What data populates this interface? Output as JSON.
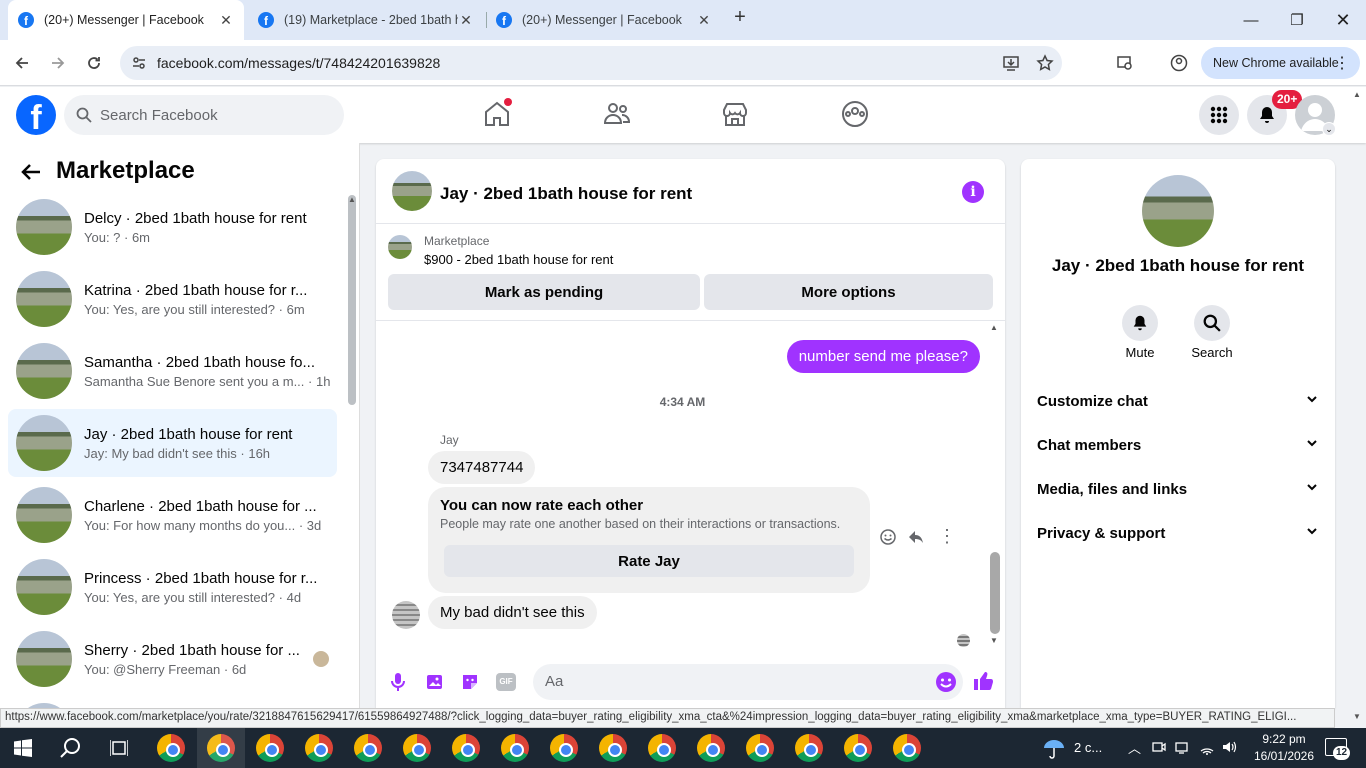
{
  "browser": {
    "tabs": [
      {
        "title": "(20+) Messenger | Facebook",
        "active": true
      },
      {
        "title": "(19) Marketplace - 2bed 1bath h",
        "active": false
      },
      {
        "title": "(20+) Messenger | Facebook",
        "active": false
      }
    ],
    "new_tab_label": "+",
    "url": "facebook.com/messages/t/748424201639828",
    "new_chrome_label": "New Chrome available"
  },
  "fb": {
    "logo_letter": "f",
    "search_placeholder": "Search Facebook",
    "notifications_badge": "20+"
  },
  "sidebar": {
    "title": "Marketplace",
    "conversations": [
      {
        "name": "Delcy · 2bed 1bath house for rent",
        "preview": "You: ? · 6m",
        "selected": false
      },
      {
        "name": "Katrina · 2bed 1bath house for r...",
        "preview": "You: Yes, are you still interested? · 6m",
        "selected": false
      },
      {
        "name": "Samantha · 2bed 1bath house fo...",
        "preview": "Samantha Sue Benore sent you a m... · 1h",
        "selected": false
      },
      {
        "name": "Jay · 2bed 1bath house for rent",
        "preview": "Jay: My bad didn't see this · 16h",
        "selected": true
      },
      {
        "name": "Charlene · 2bed 1bath house for ...",
        "preview": "You: For how many months do you... · 3d",
        "selected": false
      },
      {
        "name": "Princess · 2bed 1bath house for r...",
        "preview": "You: Yes, are you still interested? · 4d",
        "selected": false
      },
      {
        "name": "Sherry · 2bed 1bath house for ...",
        "preview": "You: @Sherry Freeman · 6d",
        "selected": false
      }
    ]
  },
  "chat": {
    "title": "Jay · 2bed 1bath house for rent",
    "listing_label": "Marketplace",
    "listing_title": "$900 - 2bed 1bath house for rent",
    "mark_pending_label": "Mark as pending",
    "more_options_label": "More options",
    "outgoing_message": "number send me please?",
    "timestamp": "4:34 AM",
    "sender_name": "Jay",
    "incoming_number": "7347487744",
    "rate_card_title": "You can now rate each other",
    "rate_card_text": "People may rate one another based on their interactions or transactions.",
    "rate_button_label": "Rate Jay",
    "incoming_last": "My bad didn't see this",
    "composer_placeholder": "Aa",
    "gif_label": "GIF",
    "accent_color": "#a033ff"
  },
  "details": {
    "title": "Jay · 2bed 1bath house for rent",
    "mute_label": "Mute",
    "search_label": "Search",
    "sections": [
      "Customize chat",
      "Chat members",
      "Media, files and links",
      "Privacy & support"
    ]
  },
  "status_url": "https://www.facebook.com/marketplace/you/rate/3218847615629417/61559864927488/?click_logging_data=buyer_rating_eligibility_xma_cta&%24impression_logging_data=buyer_rating_eligibility_xma&marketplace_xma_type=BUYER_RATING_ELIGI...",
  "taskbar": {
    "weather": "2 c...",
    "time": "9:22 pm",
    "date": "16/01/2026",
    "notification_count": "12"
  }
}
